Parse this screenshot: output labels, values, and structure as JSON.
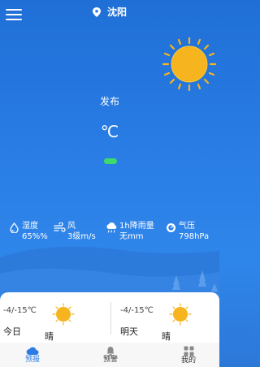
{
  "header": {
    "location": "沈阳"
  },
  "current": {
    "published": "发布",
    "temperature": "℃"
  },
  "stats": [
    {
      "icon": "humidity-icon",
      "label": "湿度",
      "value": "65%%"
    },
    {
      "icon": "wind-icon",
      "label": "风",
      "value": "3级m/s"
    },
    {
      "icon": "rain-icon",
      "label": "1h降雨量",
      "value": "无mm"
    },
    {
      "icon": "pressure-icon",
      "label": "气压",
      "value": "798hPa"
    }
  ],
  "forecast": [
    {
      "range": "-4/-15℃",
      "day": "今日",
      "condition": "晴"
    },
    {
      "range": "-4/-15℃",
      "day": "明天",
      "condition": "晴"
    }
  ],
  "tabs": [
    {
      "label": "预报",
      "icon": "cloud-icon",
      "active": true
    },
    {
      "label": "预警",
      "icon": "bell-icon",
      "active": false
    },
    {
      "label": "我的",
      "icon": "grid-icon",
      "active": false
    }
  ],
  "colors": {
    "accent": "#2c7be5",
    "aqi": "#3ddb6a",
    "sun": "#f6b51f"
  }
}
